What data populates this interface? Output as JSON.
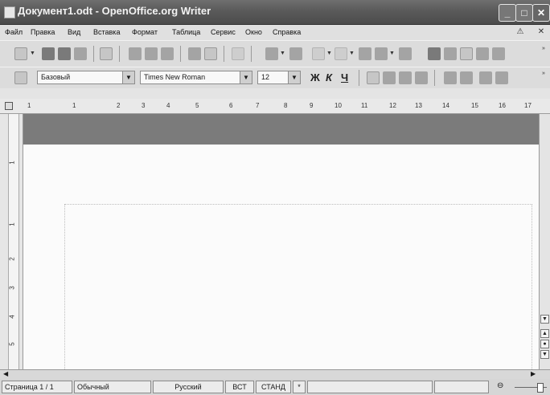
{
  "window": {
    "title": "Документ1.odt - OpenOffice.org Writer",
    "minimize_label": "_",
    "maximize_label": "□",
    "close_label": "✕"
  },
  "menu": {
    "items": [
      "Файл",
      "Правка",
      "Вид",
      "Вставка",
      "Формат",
      "Таблица",
      "Сервис",
      "Окно",
      "Справка"
    ],
    "close_doc": "✕"
  },
  "formatting": {
    "style": "Базовый",
    "font": "Times New Roman",
    "size": "12",
    "bold": "Ж",
    "italic": "К",
    "underline": "Ч"
  },
  "ruler": {
    "marks": [
      "1",
      "1",
      "2",
      "3",
      "4",
      "5",
      "6",
      "7",
      "8",
      "9",
      "10",
      "11",
      "12",
      "13",
      "14",
      "15",
      "16",
      "17"
    ],
    "vertical_marks": [
      "1",
      "1",
      "2",
      "3",
      "4",
      "5"
    ]
  },
  "status": {
    "page": "Страница 1 / 1",
    "page_style": "Обычный",
    "language": "Русский",
    "insert_mode": "ВСТ",
    "selection_mode": "СТАНД",
    "modified": "*"
  }
}
